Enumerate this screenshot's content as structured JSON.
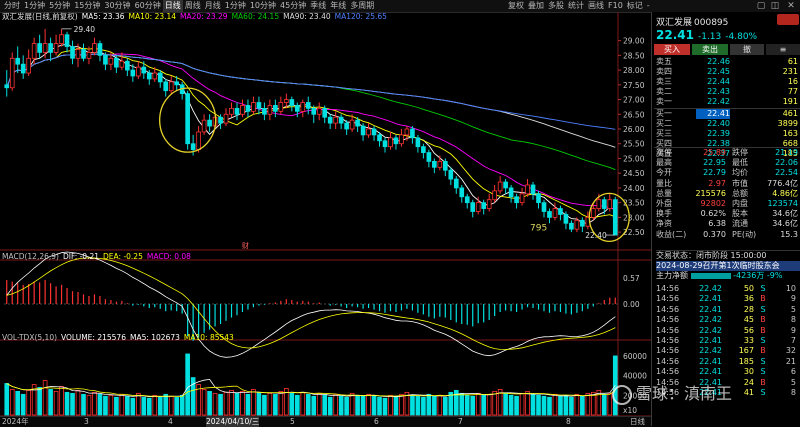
{
  "toolbar": {
    "periods": [
      "分时",
      "1分钟",
      "5分钟",
      "15分钟",
      "30分钟",
      "60分钟",
      "日线",
      "周线",
      "月线",
      "1分钟",
      "10分钟",
      "45分钟",
      "季线",
      "年线",
      "多周期"
    ],
    "active_period": 6,
    "right_menu": [
      "复权",
      "叠加",
      "多股",
      "统计",
      "画线",
      "F10",
      "标记",
      "-"
    ],
    "window_controls": [
      "▢",
      "◫",
      "✕"
    ]
  },
  "main_legend": {
    "title": "双汇发展(日线,前复权)",
    "items": [
      {
        "label": "MA5: 23.36",
        "color": "#ffffff"
      },
      {
        "label": "MA10: 23.14",
        "color": "#ffff00"
      },
      {
        "label": "MA20: 23.29",
        "color": "#ff00ff"
      },
      {
        "label": "MA60: 24.15",
        "color": "#00cc00"
      },
      {
        "label": "MA90: 23.40",
        "color": "#dddddd"
      },
      {
        "label": "MA120: 25.65",
        "color": "#4d7fff"
      }
    ]
  },
  "macd_legend": {
    "items": [
      {
        "label": "MACD(12,26,9)",
        "color": "#c0c0c0"
      },
      {
        "label": "DIF: -0.21",
        "color": "#ffffff"
      },
      {
        "label": "DEA: -0.25",
        "color": "#ffff00"
      },
      {
        "label": "MACD: 0.08",
        "color": "#ff00ff"
      }
    ]
  },
  "vol_legend": {
    "items": [
      {
        "label": "VOL-TDX(5,10)",
        "color": "#c0c0c0"
      },
      {
        "label": "VOLUME: 215576",
        "color": "#ffffff"
      },
      {
        "label": "MA5: 102673",
        "color": "#ffffff"
      },
      {
        "label": "MA10: 85543",
        "color": "#ffff00"
      }
    ]
  },
  "price_axis": [
    "29.00",
    "28.50",
    "28.00",
    "27.50",
    "27.00",
    "26.50",
    "26.00",
    "25.50",
    "25.00",
    "24.50",
    "24.00",
    "23.50",
    "23.00",
    "22.50"
  ],
  "macd_axis": [
    "0.57",
    "0.00"
  ],
  "vol_axis": [
    "60000",
    "40000",
    "20000",
    "x10"
  ],
  "annotations": {
    "high": "29.40",
    "low": "22.40",
    "count_label": "795",
    "marker": "财"
  },
  "date_axis": [
    "2024年",
    "3",
    "4",
    "2024/04/10/三",
    "5",
    "6",
    "7",
    "8"
  ],
  "date_axis_right": "日线",
  "chart_data": {
    "type": "candlestick",
    "x_range": [
      "2024-02",
      "2024-08-29"
    ],
    "ylim": [
      22.3,
      29.7
    ],
    "candles": [
      [
        27.5,
        27.4,
        28.0,
        27.1
      ],
      [
        27.4,
        28.4,
        28.6,
        27.3
      ],
      [
        28.4,
        28.2,
        28.8,
        27.9
      ],
      [
        28.2,
        27.9,
        28.5,
        27.7
      ],
      [
        27.9,
        28.4,
        28.7,
        27.8
      ],
      [
        28.4,
        28.9,
        29.1,
        28.2
      ],
      [
        28.9,
        28.6,
        29.2,
        28.4
      ],
      [
        28.6,
        28.9,
        29.4,
        28.4
      ],
      [
        28.9,
        28.6,
        29.1,
        28.3
      ],
      [
        28.6,
        28.9,
        29.2,
        28.5
      ],
      [
        28.9,
        29.2,
        29.4,
        28.8
      ],
      [
        29.2,
        28.8,
        29.3,
        28.6
      ],
      [
        28.8,
        28.4,
        29.0,
        28.2
      ],
      [
        28.4,
        28.7,
        28.9,
        28.1
      ],
      [
        28.7,
        28.4,
        28.9,
        28.3
      ],
      [
        28.4,
        28.6,
        28.8,
        28.2
      ],
      [
        28.6,
        28.9,
        29.1,
        28.5
      ],
      [
        28.9,
        28.5,
        29.0,
        28.3
      ],
      [
        28.5,
        28.2,
        28.6,
        28.0
      ],
      [
        28.2,
        28.4,
        28.6,
        28.0
      ],
      [
        28.4,
        28.1,
        28.5,
        27.9
      ],
      [
        28.1,
        28.3,
        28.6,
        28.0
      ],
      [
        28.3,
        28.0,
        28.4,
        27.8
      ],
      [
        28.0,
        27.8,
        28.2,
        27.6
      ],
      [
        27.8,
        28.1,
        28.3,
        27.7
      ],
      [
        28.1,
        27.9,
        28.3,
        27.7
      ],
      [
        27.9,
        27.7,
        28.0,
        27.5
      ],
      [
        27.7,
        27.9,
        28.1,
        27.6
      ],
      [
        27.9,
        27.6,
        28.0,
        27.4
      ],
      [
        27.6,
        27.3,
        27.7,
        27.1
      ],
      [
        27.3,
        27.6,
        27.8,
        27.2
      ],
      [
        27.6,
        27.5,
        27.8,
        27.3
      ],
      [
        27.5,
        27.2,
        27.6,
        27.0
      ],
      [
        27.2,
        25.5,
        27.3,
        25.3
      ],
      [
        25.5,
        25.3,
        25.8,
        25.1
      ],
      [
        25.3,
        25.9,
        26.1,
        25.2
      ],
      [
        25.9,
        26.3,
        26.5,
        25.8
      ],
      [
        26.3,
        26.1,
        26.5,
        25.9
      ],
      [
        26.1,
        26.4,
        26.6,
        26.0
      ],
      [
        26.4,
        26.2,
        26.5,
        26.0
      ],
      [
        26.2,
        26.5,
        26.7,
        26.1
      ],
      [
        26.5,
        26.7,
        26.9,
        26.4
      ],
      [
        26.7,
        26.5,
        26.9,
        26.3
      ],
      [
        26.5,
        26.8,
        27.0,
        26.4
      ],
      [
        26.8,
        26.6,
        27.0,
        26.4
      ],
      [
        26.6,
        26.9,
        27.1,
        26.5
      ],
      [
        26.9,
        26.7,
        27.1,
        26.5
      ],
      [
        26.7,
        26.5,
        26.9,
        26.3
      ],
      [
        26.5,
        26.8,
        27.0,
        26.3
      ],
      [
        26.8,
        26.6,
        27.0,
        26.4
      ],
      [
        26.6,
        26.9,
        27.1,
        26.5
      ],
      [
        26.9,
        27.0,
        27.2,
        26.7
      ],
      [
        27.0,
        26.8,
        27.1,
        26.6
      ],
      [
        26.8,
        26.6,
        26.9,
        26.4
      ],
      [
        26.6,
        26.9,
        27.0,
        26.4
      ],
      [
        26.9,
        26.7,
        27.1,
        26.5
      ],
      [
        26.7,
        26.5,
        26.8,
        26.2
      ],
      [
        26.5,
        26.7,
        26.9,
        26.3
      ],
      [
        26.7,
        26.4,
        26.8,
        26.2
      ],
      [
        26.4,
        26.2,
        26.5,
        26.0
      ],
      [
        26.2,
        26.4,
        26.6,
        26.0
      ],
      [
        26.4,
        26.2,
        26.5,
        26.0
      ],
      [
        26.2,
        26.0,
        26.3,
        25.8
      ],
      [
        26.0,
        26.3,
        26.5,
        25.9
      ],
      [
        26.3,
        26.1,
        26.4,
        25.9
      ],
      [
        26.1,
        25.8,
        26.2,
        25.6
      ],
      [
        25.8,
        26.0,
        26.2,
        25.7
      ],
      [
        26.0,
        25.8,
        26.1,
        25.6
      ],
      [
        25.8,
        25.6,
        25.9,
        25.4
      ],
      [
        25.6,
        25.4,
        25.7,
        25.2
      ],
      [
        25.4,
        25.7,
        25.9,
        25.3
      ],
      [
        25.7,
        25.5,
        25.8,
        25.3
      ],
      [
        25.5,
        25.8,
        26.0,
        25.4
      ],
      [
        25.8,
        26.0,
        26.1,
        25.6
      ],
      [
        26.0,
        25.7,
        26.1,
        25.5
      ],
      [
        25.7,
        25.4,
        25.8,
        25.2
      ],
      [
        25.4,
        25.2,
        25.5,
        25.0
      ],
      [
        25.2,
        24.9,
        25.3,
        24.7
      ],
      [
        24.9,
        24.7,
        25.0,
        24.5
      ],
      [
        24.7,
        24.9,
        25.1,
        24.6
      ],
      [
        24.9,
        24.6,
        25.0,
        24.4
      ],
      [
        24.6,
        24.3,
        24.7,
        24.1
      ],
      [
        24.3,
        24.0,
        24.4,
        23.8
      ],
      [
        24.0,
        23.7,
        24.1,
        23.5
      ],
      [
        23.7,
        23.5,
        23.8,
        23.3
      ],
      [
        23.5,
        23.2,
        23.6,
        23.0
      ],
      [
        23.2,
        23.5,
        23.7,
        23.1
      ],
      [
        23.5,
        23.3,
        23.6,
        23.1
      ],
      [
        23.3,
        23.6,
        23.8,
        23.2
      ],
      [
        23.6,
        23.9,
        24.1,
        23.5
      ],
      [
        23.9,
        24.2,
        24.4,
        23.8
      ],
      [
        24.2,
        24.0,
        24.3,
        23.8
      ],
      [
        24.0,
        23.7,
        24.1,
        23.5
      ],
      [
        23.7,
        23.5,
        23.8,
        23.3
      ],
      [
        23.5,
        23.8,
        24.0,
        23.4
      ],
      [
        23.8,
        24.1,
        24.3,
        23.7
      ],
      [
        24.1,
        23.8,
        24.2,
        23.6
      ],
      [
        23.8,
        23.5,
        23.9,
        23.3
      ],
      [
        23.5,
        23.2,
        23.6,
        23.0
      ],
      [
        23.2,
        23.0,
        23.3,
        22.8
      ],
      [
        23.0,
        23.3,
        23.5,
        22.9
      ],
      [
        23.3,
        23.1,
        23.4,
        22.9
      ],
      [
        23.1,
        22.8,
        23.2,
        22.6
      ],
      [
        22.8,
        22.6,
        22.9,
        22.5
      ],
      [
        22.6,
        22.9,
        23.0,
        22.5
      ],
      [
        22.9,
        22.7,
        23.0,
        22.5
      ],
      [
        22.7,
        23.0,
        23.2,
        22.6
      ],
      [
        23.0,
        23.3,
        23.5,
        22.9
      ],
      [
        23.3,
        23.6,
        23.8,
        23.2
      ],
      [
        23.6,
        23.3,
        23.7,
        23.1
      ],
      [
        23.3,
        23.6,
        23.8,
        23.2
      ],
      [
        23.6,
        22.4,
        23.7,
        22.4
      ]
    ],
    "volume_x10": [
      3200,
      2600,
      2400,
      2100,
      2500,
      3100,
      2800,
      3500,
      2600,
      2400,
      2900,
      2300,
      2200,
      2500,
      2100,
      2000,
      2300,
      2100,
      1900,
      2000,
      1800,
      2100,
      1900,
      1700,
      2200,
      1800,
      1700,
      2000,
      1800,
      2100,
      1900,
      1800,
      2000,
      6200,
      3800,
      3100,
      2600,
      2400,
      2200,
      2100,
      2300,
      2500,
      2200,
      2400,
      2100,
      2600,
      2300,
      2000,
      2200,
      2100,
      2400,
      2700,
      2200,
      2000,
      2300,
      2100,
      1900,
      2200,
      2000,
      1800,
      2100,
      1900,
      1800,
      2200,
      2000,
      1900,
      2100,
      1900,
      1800,
      1700,
      2000,
      1900,
      2100,
      2300,
      2000,
      1900,
      1800,
      2100,
      1900,
      2000,
      1800,
      2300,
      2500,
      2200,
      2000,
      1900,
      2200,
      2000,
      2100,
      2400,
      2600,
      2200,
      2000,
      1900,
      2200,
      2400,
      2100,
      2000,
      1900,
      1800,
      2100,
      1900,
      2000,
      1800,
      2100,
      1900,
      2200,
      2300,
      2500,
      2100,
      2200,
      6000
    ],
    "macd_hist": [
      0.3,
      0.28,
      0.26,
      0.24,
      0.25,
      0.28,
      0.27,
      0.3,
      0.26,
      0.22,
      0.24,
      0.2,
      0.16,
      0.15,
      0.12,
      0.1,
      0.12,
      0.1,
      0.06,
      0.05,
      0.03,
      0.04,
      0.01,
      -0.02,
      -0.01,
      -0.03,
      -0.05,
      -0.04,
      -0.06,
      -0.09,
      -0.08,
      -0.09,
      -0.12,
      -0.4,
      -0.46,
      -0.42,
      -0.36,
      -0.32,
      -0.28,
      -0.25,
      -0.21,
      -0.17,
      -0.14,
      -0.1,
      -0.07,
      -0.04,
      -0.02,
      -0.01,
      0.01,
      0.02,
      0.04,
      0.06,
      0.05,
      0.03,
      0.04,
      0.03,
      0.01,
      0.02,
      0.0,
      -0.02,
      -0.01,
      -0.03,
      -0.05,
      -0.03,
      -0.04,
      -0.06,
      -0.05,
      -0.07,
      -0.09,
      -0.11,
      -0.09,
      -0.1,
      -0.08,
      -0.06,
      -0.08,
      -0.11,
      -0.13,
      -0.16,
      -0.18,
      -0.16,
      -0.17,
      -0.2,
      -0.23,
      -0.25,
      -0.26,
      -0.28,
      -0.24,
      -0.23,
      -0.2,
      -0.15,
      -0.1,
      -0.08,
      -0.09,
      -0.1,
      -0.07,
      -0.04,
      -0.05,
      -0.07,
      -0.09,
      -0.11,
      -0.09,
      -0.1,
      -0.12,
      -0.13,
      -0.11,
      -0.09,
      -0.06,
      -0.03,
      0.01,
      0.05,
      0.08,
      0.08
    ]
  },
  "panel": {
    "stock_name": "双汇发展",
    "stock_code": "000895",
    "price": "22.41",
    "change": "-1.13",
    "change_pct": "-4.80%",
    "buttons": [
      {
        "label": "买入",
        "bg": "#c0302a",
        "fg": "#ffffff"
      },
      {
        "label": "卖出",
        "bg": "#1f6b2a",
        "fg": "#ffffff"
      },
      {
        "label": "撤",
        "bg": "#333333",
        "fg": "#dddddd"
      },
      {
        "label": "≡",
        "bg": "#222222",
        "fg": "#dddddd"
      }
    ],
    "sells": [
      {
        "label": "卖五",
        "price": "22.46",
        "vol": "61"
      },
      {
        "label": "卖四",
        "price": "22.45",
        "vol": "231"
      },
      {
        "label": "卖三",
        "price": "22.44",
        "vol": "16"
      },
      {
        "label": "卖二",
        "price": "22.43",
        "vol": "77"
      },
      {
        "label": "卖一",
        "price": "22.42",
        "vol": "191"
      }
    ],
    "buys": [
      {
        "label": "买一",
        "price": "22.41",
        "vol": "461"
      },
      {
        "label": "买二",
        "price": "22.40",
        "vol": "3899"
      },
      {
        "label": "买三",
        "price": "22.39",
        "vol": "163"
      },
      {
        "label": "买四",
        "price": "22.38",
        "vol": "668"
      },
      {
        "label": "买五",
        "price": "22.37",
        "vol": "185"
      }
    ],
    "stats": [
      {
        "l1": "涨停",
        "v1": "25.89",
        "c1": "#ff4040",
        "l2": "跌停",
        "v2": "21.19",
        "c2": "#00e0e0"
      },
      {
        "l1": "最高",
        "v1": "22.95",
        "c1": "#00e0e0",
        "l2": "最低",
        "v2": "22.06",
        "c2": "#00e0e0"
      },
      {
        "l1": "今开",
        "v1": "22.79",
        "c1": "#00e0e0",
        "l2": "均价",
        "v2": "22.54",
        "c2": "#00e0e0"
      },
      {
        "l1": "量比",
        "v1": "2.97",
        "c1": "#ff4040",
        "l2": "市值",
        "v2": "776.4亿",
        "c2": "#dddddd"
      },
      {
        "l1": "总量",
        "v1": "215576",
        "c1": "#ffff55",
        "l2": "总额",
        "v2": "4.86亿",
        "c2": "#ffff55"
      },
      {
        "l1": "外盘",
        "v1": "92802",
        "c1": "#ff4040",
        "l2": "内盘",
        "v2": "123574",
        "c2": "#00e0e0"
      },
      {
        "l1": "换手",
        "v1": "0.62%",
        "c1": "#dddddd",
        "l2": "股本",
        "v2": "34.6亿",
        "c2": "#dddddd"
      },
      {
        "l1": "净资",
        "v1": "6.38",
        "c1": "#dddddd",
        "l2": "流通",
        "v2": "34.6亿",
        "c2": "#dddddd"
      },
      {
        "l1": "收益(二)",
        "v1": "0.370",
        "c1": "#dddddd",
        "l2": "PE(动)",
        "v2": "15.3",
        "c2": "#dddddd"
      }
    ],
    "trade_status": "交易状态：闭市阶段 15:00:00",
    "notice": "2024-08-29召开第1次临时股东会",
    "netflow_label": "主力净额",
    "netflow_value": "-4236万",
    "netflow_pct": "-9%",
    "ticks": [
      {
        "time": "14:56",
        "price": "22.42",
        "vol": "50",
        "dir": "S",
        "num": "10"
      },
      {
        "time": "14:56",
        "price": "22.41",
        "vol": "36",
        "dir": "B",
        "num": "9"
      },
      {
        "time": "14:56",
        "price": "22.41",
        "vol": "28",
        "dir": "S",
        "num": "5"
      },
      {
        "time": "14:56",
        "price": "22.42",
        "vol": "45",
        "dir": "B",
        "num": "8"
      },
      {
        "time": "14:56",
        "price": "22.42",
        "vol": "56",
        "dir": "B",
        "num": "9"
      },
      {
        "time": "14:56",
        "price": "22.41",
        "vol": "33",
        "dir": "S",
        "num": "7"
      },
      {
        "time": "14:56",
        "price": "22.42",
        "vol": "167",
        "dir": "B",
        "num": "32"
      },
      {
        "time": "14:56",
        "price": "22.41",
        "vol": "185",
        "dir": "S",
        "num": "21"
      },
      {
        "time": "14:56",
        "price": "22.41",
        "vol": "30",
        "dir": "S",
        "num": "6"
      },
      {
        "time": "14:56",
        "price": "22.41",
        "vol": "24",
        "dir": "B",
        "num": "5"
      },
      {
        "time": "14:56",
        "price": "22.41",
        "vol": "41",
        "dir": "S",
        "num": "8"
      }
    ]
  },
  "watermark": "雪球：滇南王",
  "colors": {
    "up": "#ff3232",
    "down": "#00e0e0",
    "bg": "#000000"
  }
}
